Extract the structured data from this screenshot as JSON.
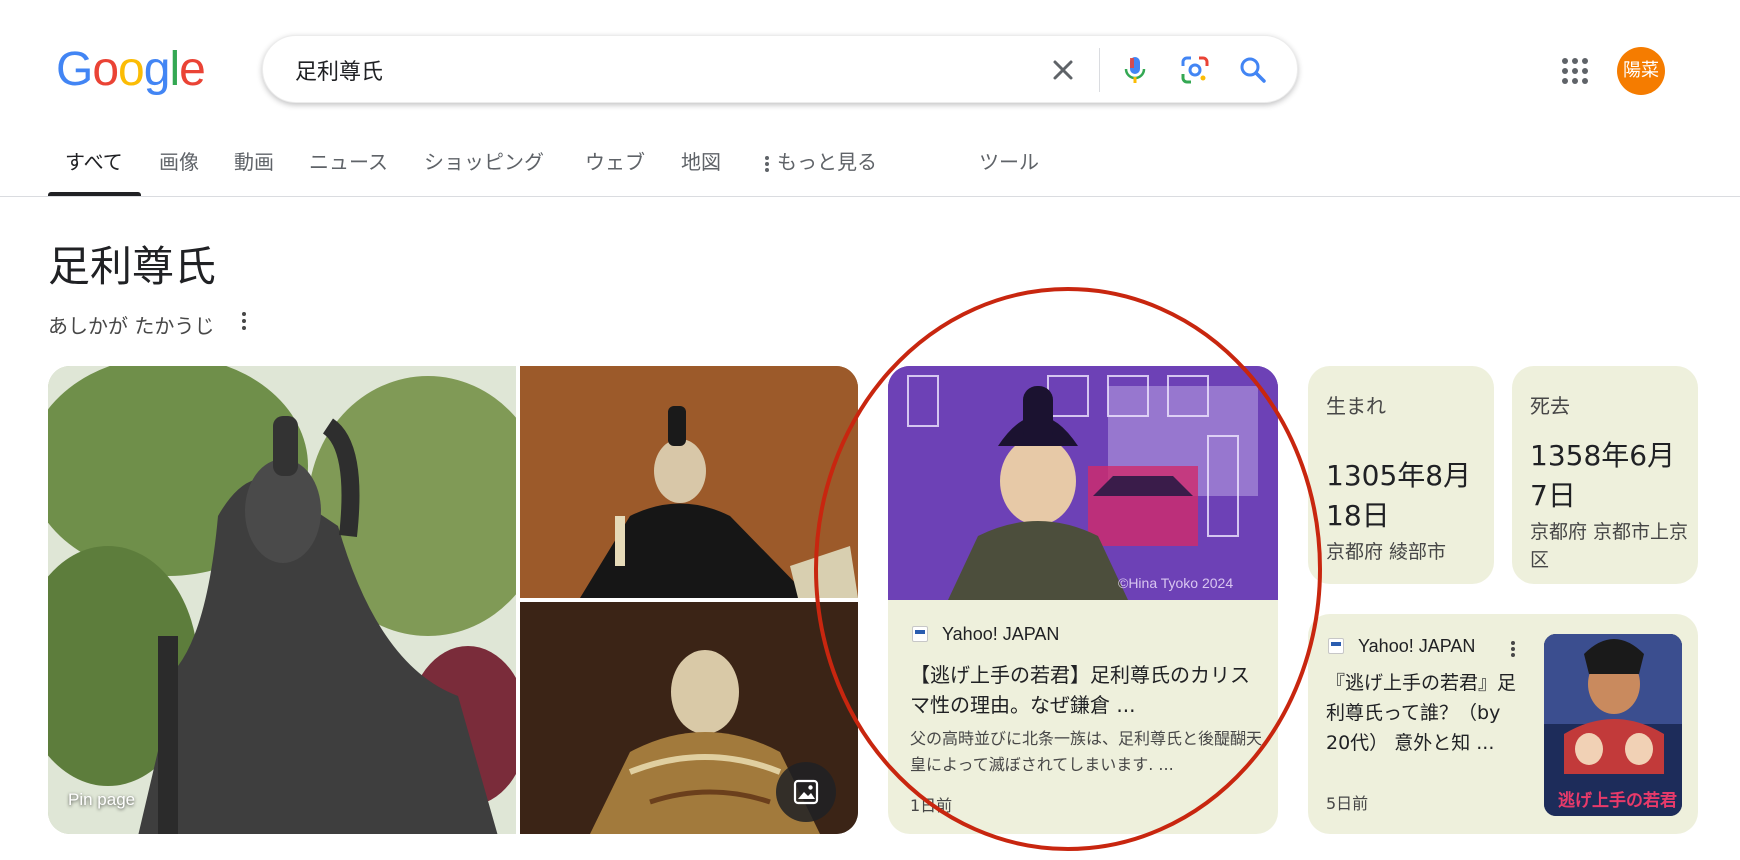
{
  "header": {
    "logo_letters": [
      "G",
      "o",
      "o",
      "g",
      "l",
      "e"
    ],
    "search_value": "足利尊氏",
    "avatar_text": "陽菜",
    "avatar_color": "#f57c00"
  },
  "tabs": [
    {
      "label": "すべて",
      "active": true
    },
    {
      "label": "画像"
    },
    {
      "label": "動画"
    },
    {
      "label": "ニュース"
    },
    {
      "label": "ショッピング"
    },
    {
      "label": "ウェブ"
    },
    {
      "label": "地図"
    },
    {
      "label": "もっと見る"
    },
    {
      "label": "ツール"
    }
  ],
  "knowledge_panel": {
    "title": "足利尊氏",
    "reading": "あしかが たかうじ",
    "gallery": {
      "pin_label": "Pin page"
    },
    "news_card_1": {
      "source": "Yahoo! JAPAN",
      "title": "【逃げ上手の若君】足利尊氏のカリスマ性の理由。なぜ鎌倉 ...",
      "snippet": "父の高時並びに北条一族は、足利尊氏と後醍醐天皇によって滅ぼされてしまいます. ...",
      "time": "1日前",
      "image_watermark": "©Hina Tyoko 2024"
    },
    "born": {
      "label": "生まれ",
      "date": "1305年8月18日",
      "place": "京都府 綾部市"
    },
    "died": {
      "label": "死去",
      "date": "1358年6月7日",
      "place": "京都府 京都市上京区"
    },
    "news_card_2": {
      "source": "Yahoo! JAPAN",
      "title": "『逃げ上手の若君』足利尊氏って誰？（by 20代） 意外と知 ...",
      "time": "5日前",
      "thumb_text": "逃げ上手の若君"
    }
  },
  "colors": {
    "card_bg": "#eef0dc",
    "annotation": "#c8260f"
  },
  "icons": [
    "clear-icon",
    "mic-icon",
    "lens-icon",
    "search-icon",
    "apps-grid-icon",
    "more-vert-icon",
    "image-search-icon"
  ]
}
